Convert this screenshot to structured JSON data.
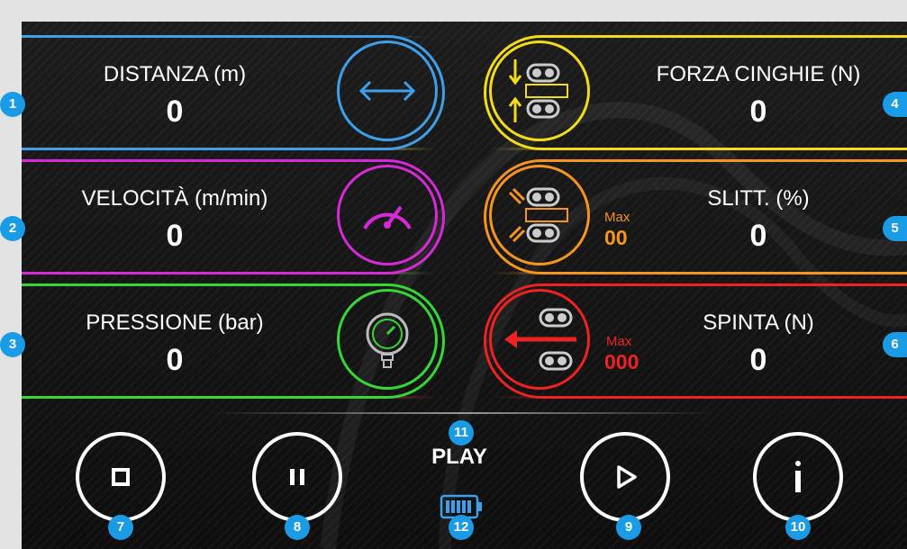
{
  "metrics": {
    "distance": {
      "label": "DISTANZA (m)",
      "value": "0",
      "badge": "1"
    },
    "speed": {
      "label": "VELOCITÀ (m/min)",
      "value": "0",
      "badge": "2"
    },
    "pressure": {
      "label": "PRESSIONE (bar)",
      "value": "0",
      "badge": "3"
    },
    "belt_force": {
      "label": "FORZA CINGHIE (N)",
      "value": "0",
      "badge": "4"
    },
    "slip": {
      "label": "SLITT. (%)",
      "value": "0",
      "max_label": "Max",
      "max_value": "00",
      "badge": "5"
    },
    "thrust": {
      "label": "SPINTA (N)",
      "value": "0",
      "max_label": "Max",
      "max_value": "000",
      "badge": "6"
    }
  },
  "controls": {
    "stop_badge": "7",
    "pause_badge": "8",
    "play_badge": "9",
    "info_badge": "10",
    "status_label": "PLAY",
    "status_badge": "11",
    "battery_badge": "12"
  },
  "colors": {
    "distance": "#3f9fe8",
    "speed": "#d62ad6",
    "pressure": "#35d635",
    "belt_force": "#f2dc1a",
    "slip": "#f5941f",
    "thrust": "#ee2222",
    "battery": "#3f9fe8",
    "badge": "#1a9be6"
  },
  "icons": {
    "distance": "double-arrow-icon",
    "speed": "speedometer-icon",
    "pressure": "pressure-gauge-icon",
    "belt_force": "belt-squeeze-icon",
    "slip": "belt-slip-icon",
    "thrust": "thrust-arrow-icon",
    "stop": "stop-icon",
    "pause": "pause-icon",
    "play": "play-icon",
    "info": "info-icon",
    "battery": "battery-icon"
  }
}
